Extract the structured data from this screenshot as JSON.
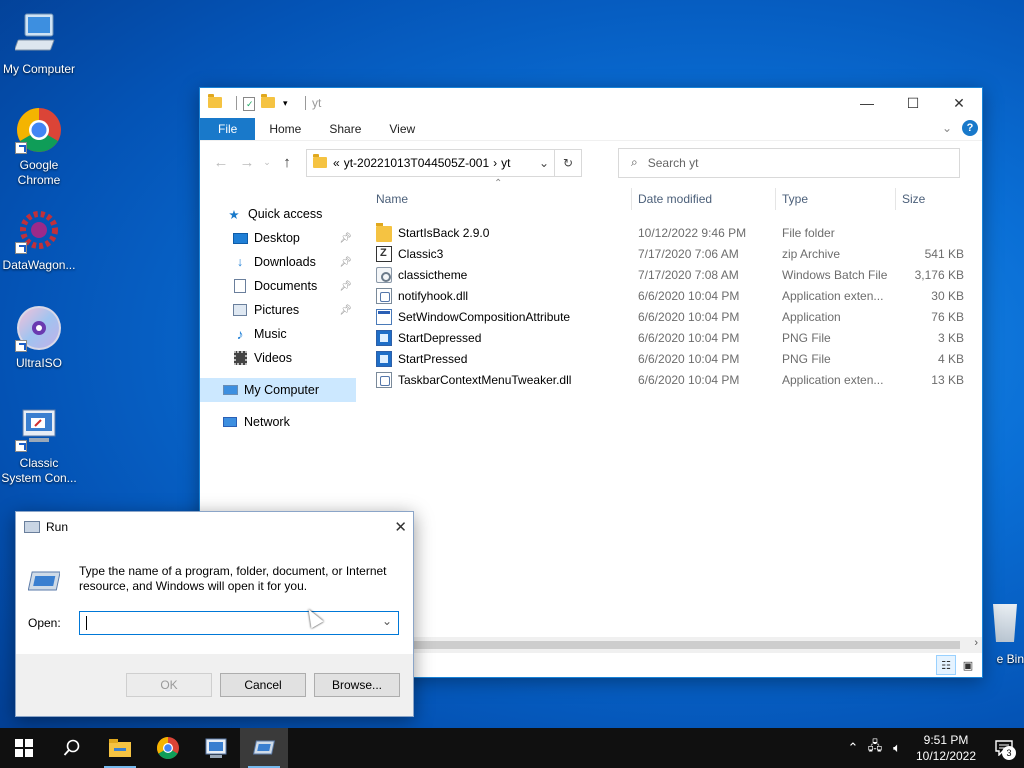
{
  "desktop": {
    "icons": [
      {
        "label": "My Computer"
      },
      {
        "label": "Google Chrome"
      },
      {
        "label": "DataWagon..."
      },
      {
        "label": "UltraISO"
      },
      {
        "label": "Classic System Con..."
      }
    ],
    "recycle_label": "e Bin"
  },
  "explorer": {
    "title": "yt",
    "controls": {
      "minimize": "—",
      "maximize": "☐",
      "close": "✕"
    },
    "ribbon": {
      "file": "File",
      "home": "Home",
      "share": "Share",
      "view": "View"
    },
    "address": {
      "prefix": "«",
      "crumb1": "yt-20221013T044505Z-001",
      "sep": "›",
      "crumb2": "yt"
    },
    "search_placeholder": "Search yt",
    "nav": {
      "quick_access": "Quick access",
      "desktop": "Desktop",
      "downloads": "Downloads",
      "documents": "Documents",
      "pictures": "Pictures",
      "music": "Music",
      "videos": "Videos",
      "my_computer": "My Computer",
      "network": "Network"
    },
    "columns": {
      "name": "Name",
      "date": "Date modified",
      "type": "Type",
      "size": "Size"
    },
    "files": [
      {
        "name": "StartIsBack 2.9.0",
        "date": "10/12/2022 9:46 PM",
        "type": "File folder",
        "size": "",
        "icon": "folder-icon"
      },
      {
        "name": "Classic3",
        "date": "7/17/2020 7:06 AM",
        "type": "zip Archive",
        "size": "541 KB",
        "icon": "zip-icon"
      },
      {
        "name": "classictheme",
        "date": "7/17/2020 7:08 AM",
        "type": "Windows Batch File",
        "size": "3,176 KB",
        "icon": "gear-icon"
      },
      {
        "name": "notifyhook.dll",
        "date": "6/6/2020 10:04 PM",
        "type": "Application exten...",
        "size": "30 KB",
        "icon": "dll-icon"
      },
      {
        "name": "SetWindowCompositionAttribute",
        "date": "6/6/2020 10:04 PM",
        "type": "Application",
        "size": "76 KB",
        "icon": "app-icon"
      },
      {
        "name": "StartDepressed",
        "date": "6/6/2020 10:04 PM",
        "type": "PNG File",
        "size": "3 KB",
        "icon": "png-icon"
      },
      {
        "name": "StartPressed",
        "date": "6/6/2020 10:04 PM",
        "type": "PNG File",
        "size": "4 KB",
        "icon": "png-icon"
      },
      {
        "name": "TaskbarContextMenuTweaker.dll",
        "date": "6/6/2020 10:04 PM",
        "type": "Application exten...",
        "size": "13 KB",
        "icon": "dll-icon"
      }
    ]
  },
  "run": {
    "title": "Run",
    "description": "Type the name of a program, folder, document, or Internet resource, and Windows will open it for you.",
    "open_label": "Open:",
    "input_value": "",
    "ok": "OK",
    "cancel": "Cancel",
    "browse": "Browse..."
  },
  "taskbar": {
    "time": "9:51 PM",
    "date": "10/12/2022",
    "notifications": "3"
  },
  "colors": {
    "accent": "#1979ca",
    "taskbar": "#101010",
    "selection": "#cce8ff"
  }
}
